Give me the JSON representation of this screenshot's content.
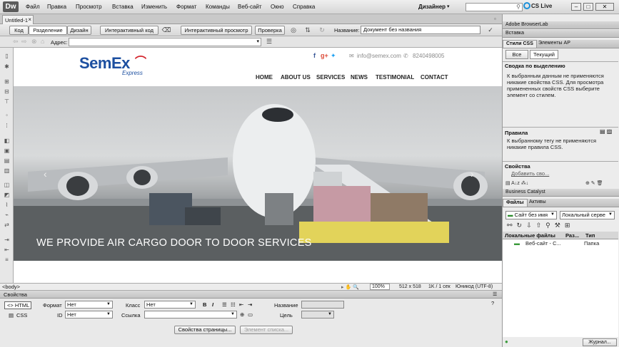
{
  "app": {
    "logo": "Dw",
    "menu": [
      "Файл",
      "Правка",
      "Просмотр",
      "Вставка",
      "Изменить",
      "Формат",
      "Команды",
      "Веб-сайт",
      "Окно",
      "Справка"
    ],
    "workspace": "Дизайнер",
    "cs_live": "CS Live"
  },
  "document_tab": {
    "name": "Untitled-1"
  },
  "toolbar": {
    "code": "Код",
    "split": "Разделение",
    "design": "Дизайн",
    "live_code": "Интерактивный код",
    "live_view": "Интерактивный просмотр",
    "inspect": "Проверка",
    "title_label": "Название:",
    "title_value": "Документ без названия"
  },
  "address": {
    "label": "Адрес:",
    "value": ""
  },
  "page": {
    "logo": "SemEx",
    "logo_sub": "Express",
    "email": "info@semex.com",
    "phone": "8240498005",
    "nav": [
      "HOME",
      "ABOUT US",
      "SERVICES",
      "NEWS",
      "TESTIMONIAL",
      "CONTACT"
    ],
    "hero_caption": "WE PROVIDE AIR CARGO DOOR TO DOOR SERVICES"
  },
  "status": {
    "tag": "<body>",
    "zoom": "100%",
    "size": "512 x 518",
    "download": "1K / 1 сек",
    "encoding": "Юникод (UTF-8)"
  },
  "properties": {
    "title": "Свойства",
    "html": "HTML",
    "css": "CSS",
    "format_label": "Формат",
    "format_value": "Нет",
    "id_label": "ID",
    "id_value": "Нет",
    "class_label": "Класс",
    "class_value": "Нет",
    "link_label": "Ссылка",
    "name_label": "Название",
    "target_label": "Цель",
    "page_props": "Свойства страницы...",
    "list_item": "Элемент списка..."
  },
  "right": {
    "browserlab": "Adobe BrowserLab",
    "insert": "Вставка",
    "css_styles_tab": "Стили CSS",
    "ap_elements_tab": "Элементы AP",
    "all_btn": "Все",
    "current_btn": "Текущий",
    "summary_title": "Сводка по выделению",
    "summary_text": "К выбранным данным не применяются никакие свойства CSS.  Для просмотра примененных свойств CSS выберите элемент со стилем.",
    "rules_title": "Правила",
    "rules_text": "К выбранному тегу не применяются никакие правила CSS.",
    "props_title": "Свойства",
    "add_property": "Добавить сво...",
    "business_catalyst": "Business Catalyst",
    "files_tab": "Файлы",
    "assets_tab": "Активы",
    "site_select": "Сайт без имя",
    "view_select": "Локальный серве",
    "col_local": "Локальные файлы",
    "col_size": "Раз...",
    "col_type": "Тип",
    "site_row_name": "Веб-сайт - С...",
    "site_row_type": "Папка",
    "journal": "Журнал..."
  }
}
